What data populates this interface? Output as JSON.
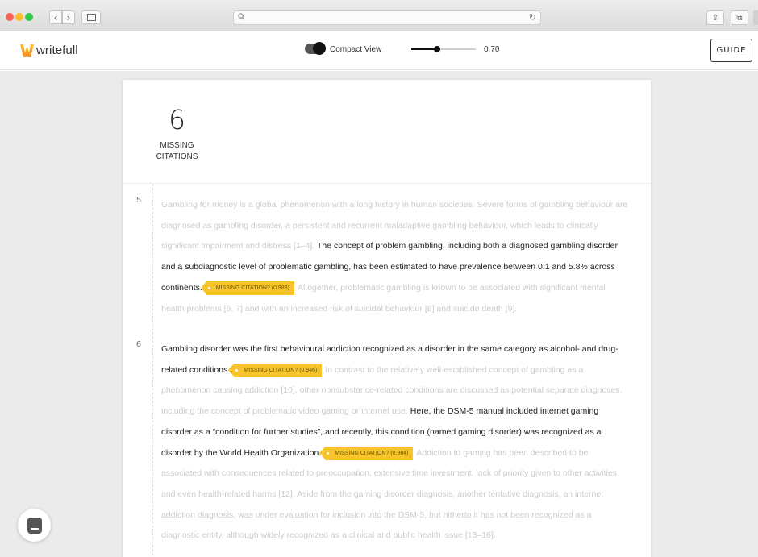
{
  "browser": {
    "back_glyph": "‹",
    "forward_glyph": "›",
    "search_icon": "search-icon",
    "reload_glyph": "↻",
    "share_glyph": "⇧",
    "tabs_glyph": "⧉"
  },
  "toolbar": {
    "logo_text": "writefull",
    "compact_view_label": "Compact View",
    "compact_view_on": true,
    "slider_value": "0.70",
    "slider_fraction": 0.4,
    "guide_label": "GUIDE"
  },
  "summary": {
    "count": "6",
    "label_line1": "MISSING",
    "label_line2": "CITATIONS"
  },
  "paragraphs": [
    {
      "number": "5",
      "segments": [
        {
          "text": "Gambling for money is a global phenomenon with a long history in human societies. Severe forms of gambling behaviour are diagnosed as gambling disorder, a persistent and recurrent maladaptive gambling behaviour, which leads to clinically significant impairment and distress [1–4]. ",
          "highlight": false
        },
        {
          "text": "The concept of problem gambling, including both a diagnosed gambling disorder and a subdiagnostic level of problematic gambling, has been estimated to have prevalence between 0.1 and 5.8% across continents.",
          "highlight": true
        },
        {
          "badge": "MISSING CITATION? (0.983)"
        },
        {
          "text": "Altogether, problematic gambling is known to be associated with significant mental health problems [6, 7] and with an increased risk of suicidal behaviour [8] and suicide death [9].",
          "highlight": false
        }
      ]
    },
    {
      "number": "6",
      "segments": [
        {
          "text": "Gambling disorder was the first behavioural addiction recognized as a disorder in the same category as alcohol- and drug-related conditions.",
          "highlight": true
        },
        {
          "badge": "MISSING CITATION? (0.946)"
        },
        {
          "text": "In contrast to the relatively well-established concept of gambling as a phenomenon causing addiction [10], other nonsubstance-related conditions are discussed as potential separate diagnoses, including the concept of problematic video gaming or internet use. ",
          "highlight": false
        },
        {
          "text": "Here, the DSM-5 manual included internet gaming disorder as a “condition for further studies”, and recently, this condition (named gaming disorder) was recognized as a disorder by the World Health Organization.",
          "highlight": true
        },
        {
          "badge": "MISSING CITATION? (0.984)"
        },
        {
          "text": "Addiction to gaming has been described to be associated with consequences related to preoccupation, extensive time investment, lack of priority given to other activities, and even health-related harms [12]. Aside from the gaming disorder diagnosis, another tentative diagnosis, an internet addiction diagnosis, was under evaluation for inclusion into the DSM-5, but hitherto it has not been recognized as a diagnostic entity, although widely recognized as a clinical and public health issue [13–16].",
          "highlight": false
        }
      ]
    }
  ],
  "colors": {
    "badge": "#f7c52b",
    "faded_text": "#cccccc",
    "highlight_text": "#1f1f1f",
    "canvas": "#ebebeb"
  }
}
